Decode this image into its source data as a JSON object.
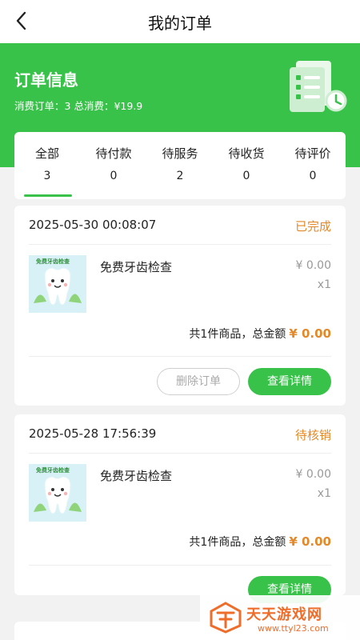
{
  "header": {
    "title": "我的订单"
  },
  "banner": {
    "title": "订单信息",
    "orders_label": "消费订单：",
    "orders_count": "3",
    "total_label": "总消费：",
    "total_value": "¥19.9",
    "accent": "#39c24a"
  },
  "tabs": [
    {
      "label": "全部",
      "count": "3",
      "active": true
    },
    {
      "label": "待付款",
      "count": "0"
    },
    {
      "label": "待服务",
      "count": "2"
    },
    {
      "label": "待收货",
      "count": "0"
    },
    {
      "label": "待评价",
      "count": "0"
    }
  ],
  "orders": [
    {
      "date": "2025-05-30 00:08:07",
      "status": "已完成",
      "thumb_label": "免费牙齿检查",
      "product": "免费牙齿检查",
      "price": "¥ 0.00",
      "qty": "x1",
      "summary": "共1件商品，总金额",
      "total": "¥ 0.00",
      "delete_label": "删除订单",
      "detail_label": "查看详情"
    },
    {
      "date": "2025-05-28 17:56:39",
      "status": "待核销",
      "thumb_label": "免费牙齿检查",
      "product": "免费牙齿检查",
      "price": "¥ 0.00",
      "qty": "x1",
      "summary": "共1件商品，总金额",
      "total": "¥ 0.00",
      "detail_label": "查看详情"
    }
  ],
  "watermark": {
    "title": "天天游戏网",
    "url": "www.ttyl23.com"
  },
  "colors": {
    "accent": "#39c24a",
    "status": "#e3892a"
  }
}
